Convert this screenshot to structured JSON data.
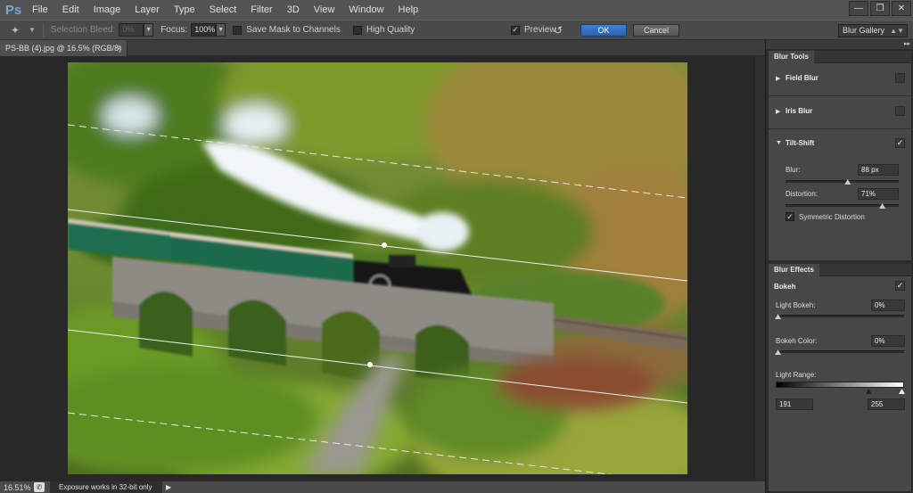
{
  "menubar": {
    "logo": "Ps",
    "items": [
      "File",
      "Edit",
      "Image",
      "Layer",
      "Type",
      "Select",
      "Filter",
      "3D",
      "View",
      "Window",
      "Help"
    ]
  },
  "options": {
    "selection_bleed_label": "Selection Bleed:",
    "selection_bleed_value": "0%",
    "focus_label": "Focus:",
    "focus_value": "100%",
    "save_mask_label": "Save Mask to Channels",
    "high_quality_label": "High Quality",
    "preview_label": "Preview",
    "ok_label": "OK",
    "cancel_label": "Cancel",
    "workspace": "Blur Gallery"
  },
  "document": {
    "tab_title": "PS-BB (4).jpg @ 16.5% (RGB/8)"
  },
  "status": {
    "zoom": "16.51%",
    "message": "Exposure works in 32-bit only"
  },
  "blur_tools": {
    "tab": "Blur Tools",
    "field_blur": "Field Blur",
    "iris_blur": "Iris Blur",
    "tilt_shift": "Tilt-Shift",
    "blur_label": "Blur:",
    "blur_value": "88 px",
    "blur_level": 0.55,
    "distortion_label": "Distortion:",
    "distortion_value": "71%",
    "distortion_level": 0.855,
    "symmetric_label": "Symmetric Distortion"
  },
  "blur_effects": {
    "tab": "Blur Effects",
    "bokeh": "Bokeh",
    "light_bokeh_label": "Light Bokeh:",
    "light_bokeh_value": "0%",
    "bokeh_color_label": "Bokeh Color:",
    "bokeh_color_value": "0%",
    "light_range_label": "Light Range:",
    "light_range_low": "191",
    "light_range_high": "255"
  },
  "colors": {
    "accent": "#2f6fc4",
    "panel": "#474747",
    "canvas_bg": "#282828"
  }
}
